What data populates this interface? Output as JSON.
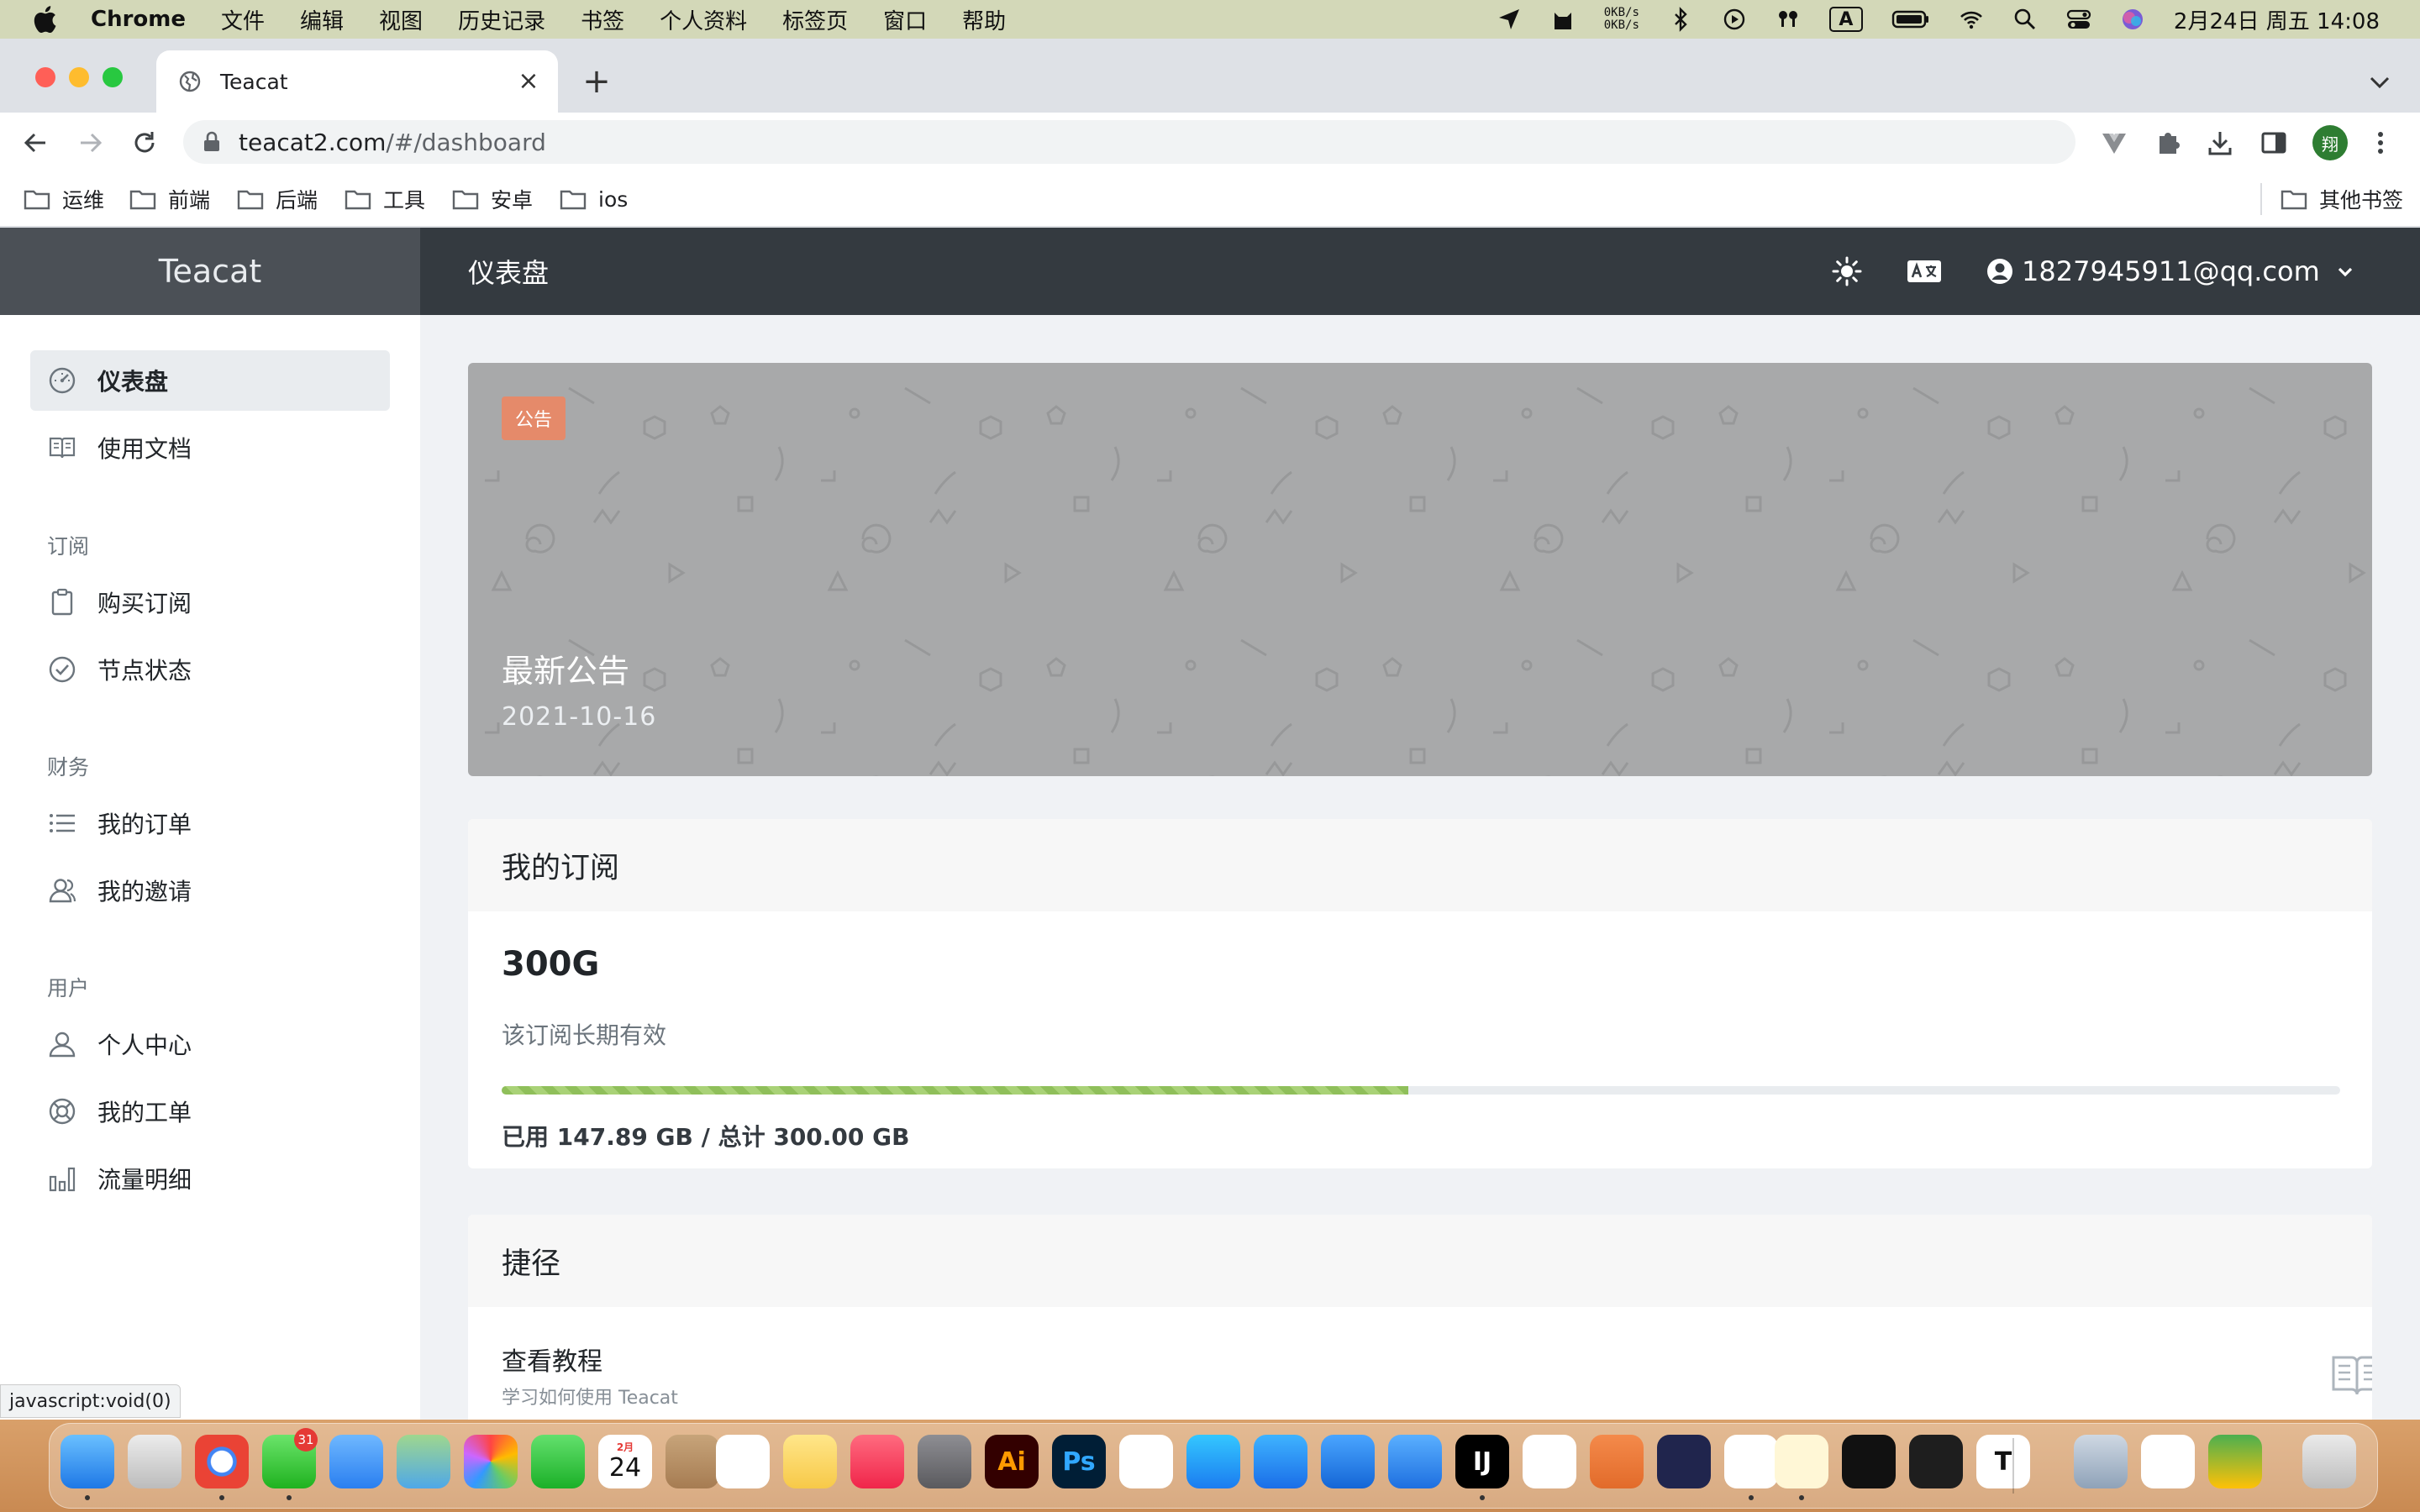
{
  "menubar": {
    "app_name": "Chrome",
    "menus": [
      "文件",
      "编辑",
      "视图",
      "历史记录",
      "书签",
      "个人资料",
      "标签页",
      "窗口",
      "帮助"
    ],
    "net_up": "0KB/s",
    "net_down": "0KB/s",
    "input_indicator": "A",
    "clock": "2月24日 周五 14:08"
  },
  "browser": {
    "tab_title": "Teacat",
    "url_host": "teacat2.com",
    "url_path": "/#/dashboard",
    "profile_initial": "翔",
    "bookmarks": [
      "运维",
      "前端",
      "后端",
      "工具",
      "安卓",
      "ios"
    ],
    "other_bookmarks": "其他书签",
    "status_url": "javascript:void(0)"
  },
  "app": {
    "brand": "Teacat",
    "page_title": "仪表盘",
    "user_email": "1827945911@qq.com"
  },
  "sidebar": {
    "items_top": [
      {
        "label": "仪表盘",
        "icon": "dashboard-gauge-icon"
      },
      {
        "label": "使用文档",
        "icon": "book-icon"
      }
    ],
    "sections": [
      {
        "title": "订阅",
        "items": [
          {
            "label": "购买订阅",
            "icon": "clipboard-icon"
          },
          {
            "label": "节点状态",
            "icon": "check-circle-icon"
          }
        ]
      },
      {
        "title": "财务",
        "items": [
          {
            "label": "我的订单",
            "icon": "list-icon"
          },
          {
            "label": "我的邀请",
            "icon": "users-icon"
          }
        ]
      },
      {
        "title": "用户",
        "items": [
          {
            "label": "个人中心",
            "icon": "user-icon"
          },
          {
            "label": "我的工单",
            "icon": "support-icon"
          },
          {
            "label": "流量明细",
            "icon": "bar-chart-icon"
          }
        ]
      }
    ]
  },
  "announcement": {
    "badge": "公告",
    "title": "最新公告",
    "date": "2021-10-16"
  },
  "subscription": {
    "header": "我的订阅",
    "plan": "300G",
    "validity": "该订阅长期有效",
    "used_fraction": 0.493,
    "usage_text": "已用 147.89 GB / 总计 300.00 GB"
  },
  "shortcuts": {
    "header": "捷径",
    "items": [
      {
        "title": "查看教程",
        "desc": "学习如何使用 Teacat",
        "icon": "book-open-icon"
      }
    ]
  },
  "colors": {
    "header_bg": "#343a40",
    "brand_bg": "#4b5056",
    "announce_bg": "#a8a9aa",
    "badge_bg": "#e58a6a",
    "progress_fill": "#8fbf5a"
  },
  "dock": {
    "messages_badge": "31",
    "calendar_month": "2月",
    "calendar_day": "24",
    "apps": [
      "finder-icon",
      "launchpad-icon",
      "chrome-icon",
      "messages-icon",
      "mail-icon",
      "maps-icon",
      "photos-icon",
      "facetime-icon",
      "calendar-icon",
      "contacts-icon",
      "reminders-icon",
      "notes-icon",
      "music-icon",
      "system-preferences-icon",
      "illustrator-icon",
      "photoshop-icon",
      "chatgpt-icon",
      "app-store-icon",
      "app-store-alt-icon",
      "xcode-icon",
      "simulator-icon",
      "intellij-icon",
      "ai-app-icon",
      "pen-icon",
      "cloud-app-icon",
      "redis-icon",
      "clashx-icon",
      "activity-monitor-icon",
      "terminal-icon",
      "typora-icon",
      "preview-icon",
      "netease-music-icon",
      "qq-music-icon",
      "trash-icon"
    ]
  }
}
